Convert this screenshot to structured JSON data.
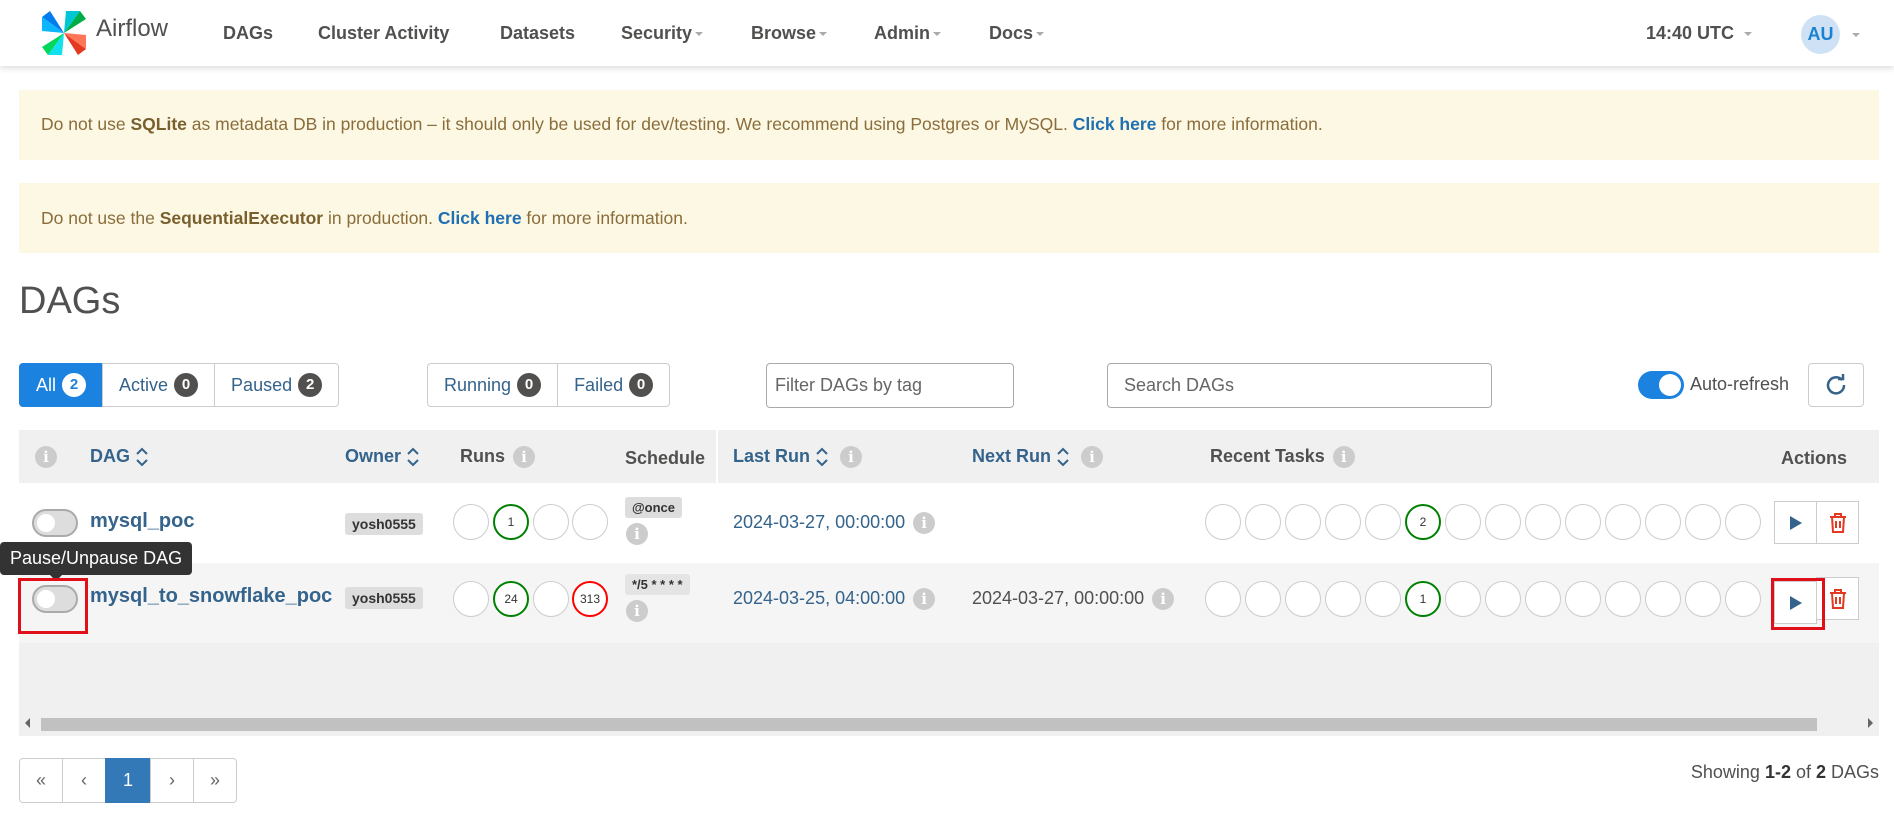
{
  "brand": {
    "name": "Airflow"
  },
  "nav": {
    "items": [
      {
        "label": "DAGs"
      },
      {
        "label": "Cluster Activity"
      },
      {
        "label": "Datasets"
      },
      {
        "label": "Security"
      },
      {
        "label": "Browse"
      },
      {
        "label": "Admin"
      },
      {
        "label": "Docs"
      }
    ],
    "clock": "14:40 UTC",
    "user_initials": "AU"
  },
  "alerts": {
    "sqlite": {
      "pre": "Do not use ",
      "bold": "SQLite",
      "mid": " as metadata DB in production – it should only be used for dev/testing. We recommend using Postgres or MySQL. ",
      "link": "Click here",
      "post": " for more information."
    },
    "executor": {
      "pre": "Do not use the ",
      "bold": "SequentialExecutor",
      "mid": " in production. ",
      "link": "Click here",
      "post": " for more information."
    }
  },
  "page_title": "DAGs",
  "filters": {
    "status": [
      {
        "label": "All",
        "count": "2"
      },
      {
        "label": "Active",
        "count": "0"
      },
      {
        "label": "Paused",
        "count": "2"
      }
    ],
    "run_state": [
      {
        "label": "Running",
        "count": "0"
      },
      {
        "label": "Failed",
        "count": "0"
      }
    ],
    "tag_placeholder": "Filter DAGs by tag",
    "search_placeholder": "Search DAGs",
    "auto_refresh_label": "Auto-refresh"
  },
  "table": {
    "headers": {
      "info": "i",
      "dag": "DAG",
      "owner": "Owner",
      "runs": "Runs",
      "schedule": "Schedule",
      "last_run": "Last Run",
      "next_run": "Next Run",
      "recent_tasks": "Recent Tasks",
      "actions": "Actions"
    },
    "rows": [
      {
        "name": "mysql_poc",
        "owner": "yosh0555",
        "runs": [
          "",
          "1",
          "",
          ""
        ],
        "schedule": "@once",
        "last_run": "2024-03-27, 00:00:00",
        "next_run": "",
        "recent_tasks": [
          "",
          "",
          "",
          "",
          "",
          "2",
          "",
          "",
          "",
          "",
          "",
          "",
          "",
          ""
        ]
      },
      {
        "name": "mysql_to_snowflake_poc",
        "owner": "yosh0555",
        "runs": [
          "",
          "24",
          "",
          "313"
        ],
        "schedule": "*/5 * * * *",
        "last_run": "2024-03-25, 04:00:00",
        "next_run": "2024-03-27, 00:00:00",
        "recent_tasks": [
          "",
          "",
          "",
          "",
          "",
          "1",
          "",
          "",
          "",
          "",
          "",
          "",
          "",
          ""
        ]
      }
    ]
  },
  "tooltip": "Pause/Unpause DAG",
  "pagination": {
    "pages": [
      "«",
      "‹",
      "1",
      "›",
      "»"
    ],
    "active": "1",
    "showing_pre": "Showing ",
    "showing_range": "1-2",
    "showing_mid": " of ",
    "showing_total": "2",
    "showing_post": " DAGs"
  },
  "colors": {
    "primary": "#1c82e0",
    "success": "#008000",
    "failed": "#ff0000",
    "alert_bg": "#fcf8e3",
    "link": "#34638b",
    "highlight": "#e0101a"
  }
}
